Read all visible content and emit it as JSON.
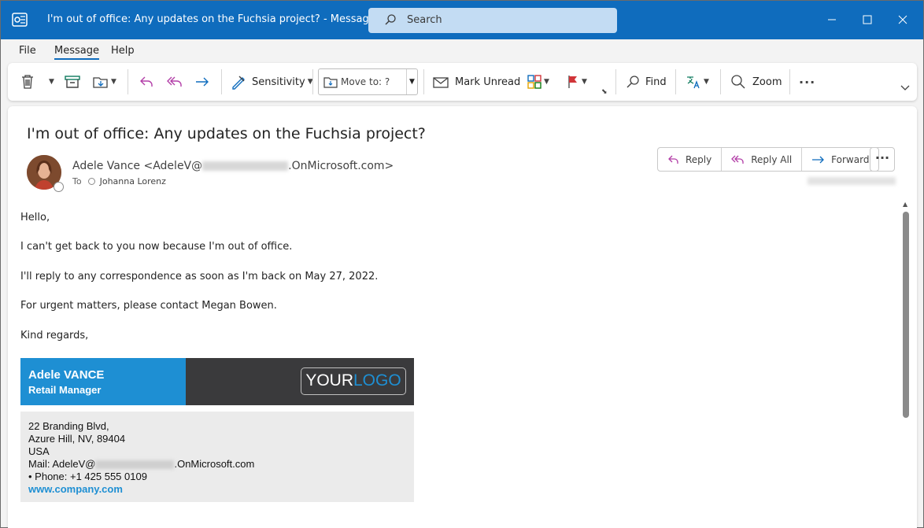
{
  "window": {
    "title": "I'm out of office: Any updates on the Fuchsia project?  -  Message (HTML)",
    "search_placeholder": "Search"
  },
  "menu": [
    {
      "label": "File"
    },
    {
      "label": "Message"
    },
    {
      "label": "Help"
    }
  ],
  "ribbon": {
    "sensitivity": "Sensitivity",
    "move_to": "Move to: ?",
    "mark_unread": "Mark Unread",
    "find": "Find",
    "zoom": "Zoom"
  },
  "message": {
    "subject": "I'm out of office: Any updates on the Fuchsia project?",
    "sender_name": "Adele Vance <AdeleV@",
    "sender_domain": ".OnMicrosoft.com>",
    "to_label": "To",
    "recipient": "Johanna Lorenz",
    "actions": {
      "reply": "Reply",
      "reply_all": "Reply All",
      "forward": "Forward"
    },
    "body": [
      "Hello,",
      "I can't get back to you now because I'm out of office.",
      "I'll reply to any correspondence as soon as I'm back on May 27, 2022.",
      "For urgent matters, please contact Megan Bowen.",
      "Kind regards,"
    ]
  },
  "signature": {
    "name": "Adele VANCE",
    "role": "Retail Manager",
    "logo_part1": "YOUR",
    "logo_part2": "LOGO",
    "address1": "22 Branding Blvd,",
    "address2": "Azure Hill, NV, 89404",
    "country": "USA",
    "mail_prefix": "Mail: AdeleV@",
    "mail_suffix": ".OnMicrosoft.com",
    "phone": "• Phone: +1 425 555 0109",
    "website": "www.company.com"
  },
  "colors": {
    "titlebar": "#0f6cbd",
    "signature_blue": "#1e8fd3",
    "signature_dark": "#3a3a3c"
  }
}
